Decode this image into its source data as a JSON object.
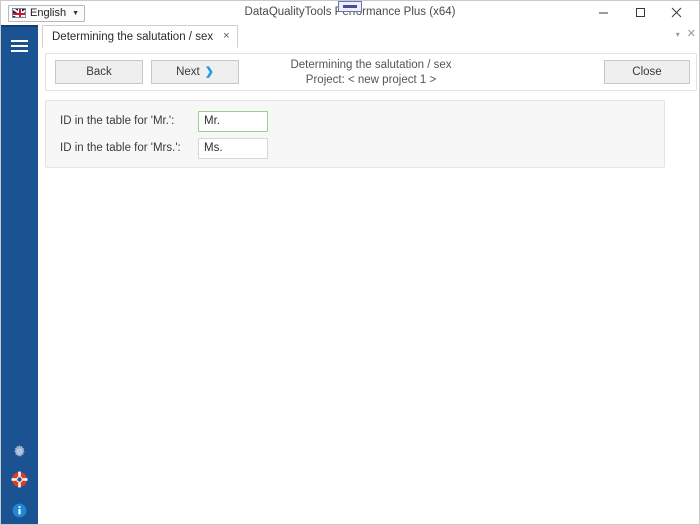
{
  "window": {
    "title": "DataQualityTools Performance Plus (x64)",
    "minimize_label": "minimize-icon",
    "maximize_label": "maximize-icon",
    "close_label": "×",
    "restore_handle": "restore-handle"
  },
  "language_selector": {
    "flag": "uk-flag-icon",
    "label": "English",
    "caret": "▼"
  },
  "sidebar": {
    "menu_button": "hamburger-icon",
    "icons": [
      {
        "name": "settings-gear-icon",
        "tooltip": "Settings"
      },
      {
        "name": "life-ring-support-icon",
        "tooltip": "Support"
      },
      {
        "name": "info-circle-icon",
        "tooltip": "Info"
      }
    ]
  },
  "tabbar": {
    "tabs": [
      {
        "label": "Determining the salutation / sex",
        "close": "×",
        "active": true
      }
    ],
    "list_caret": "▾",
    "close_all": "✕"
  },
  "toolbar": {
    "back_label": "Back",
    "next_label": "Next",
    "next_chevron": "❯",
    "close_label": "Close",
    "heading_line1": "Determining the salutation / sex",
    "heading_line2": "Project: < new project 1 >"
  },
  "form": {
    "rows": [
      {
        "label": "ID in the table for 'Mr.':",
        "value": "Mr.",
        "placeholder": "",
        "state": "valid"
      },
      {
        "label": "ID in the table for 'Mrs.':",
        "value": "Ms.",
        "placeholder": "",
        "state": "normal"
      }
    ]
  },
  "colors": {
    "sidebar_blue": "#1a5292",
    "accent_chevron": "#1d9bdb",
    "valid_border": "#9ccc8f",
    "panel_bg": "#f7f7f7",
    "support_red": "#e03a23",
    "info_blue": "#1e88d4"
  }
}
